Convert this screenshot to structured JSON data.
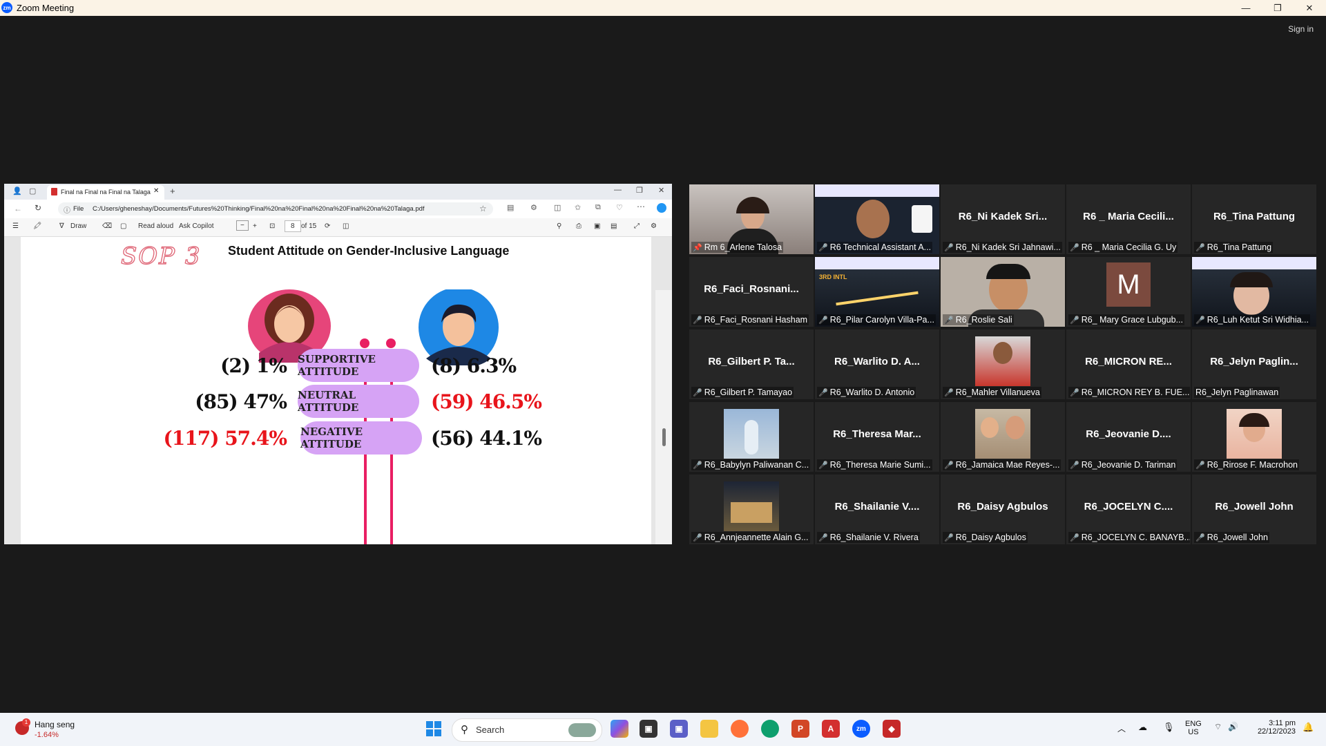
{
  "zoom": {
    "title": "Zoom Meeting",
    "logo": "zm",
    "sign_in": "Sign in",
    "window_buttons": [
      "—",
      "❐",
      "✕"
    ]
  },
  "browser": {
    "tab_title": "Final na Final na Final na Talaga.p",
    "file_label": "File",
    "url": "C:/Users/gheneshay/Documents/Futures%20Thinking/Final%20na%20Final%20na%20Final%20na%20Talaga.pdf",
    "toolbar": {
      "draw": "Draw",
      "read_aloud": "Read aloud",
      "ask_copilot": "Ask Copilot",
      "page_current": "8",
      "page_total": "of 15"
    }
  },
  "slide": {
    "sop_label": "SOP 3",
    "title": "Student Attitude on  Gender-Inclusive Language",
    "rows": [
      {
        "attitude": "SUPPORTIVE ATTITUDE",
        "female": "(2) 1%",
        "male": "(8) 6.3%",
        "female_color": "#111111",
        "male_color": "#111111"
      },
      {
        "attitude": "NEUTRAL ATTITUDE",
        "female": "(85) 47%",
        "male": "(59) 46.5%",
        "female_color": "#111111",
        "male_color": "#e8141b"
      },
      {
        "attitude": "NEGATIVE ATTITUDE",
        "female": "(117) 57.4%",
        "male": "(56) 44.1%",
        "female_color": "#e8141b",
        "male_color": "#111111"
      }
    ]
  },
  "participants": [
    {
      "big": "",
      "name": "Rm 6_Arlene Talosa",
      "video": "woman",
      "active": true,
      "pin": true
    },
    {
      "big": "",
      "name": "R6 Technical Assistant A...",
      "video": "conference-man"
    },
    {
      "big": "R6_Ni  Kadek  Sri...",
      "name": "R6_Ni Kadek Sri Jahnawi..."
    },
    {
      "big": "R6 _  Maria  Cecili...",
      "name": "R6 _ Maria Cecilia G. Uy"
    },
    {
      "big": "R6_Tina  Pattung",
      "name": "R6_Tina Pattung"
    },
    {
      "big": "R6_Faci_Rosnani...",
      "name": "R6_Faci_Rosnani Hasham"
    },
    {
      "big": "",
      "name": "R6_Pilar Carolyn Villa-Pa...",
      "video": "conference"
    },
    {
      "big": "",
      "name": "R6_Roslie Sali",
      "video": "man-glasses"
    },
    {
      "big": "M",
      "name": "R6_ Mary Grace Lubgub...",
      "video": "avatar-m"
    },
    {
      "big": "",
      "name": "R6_Luh Ketut Sri Widhia...",
      "video": "conference-girl"
    },
    {
      "big": "R6_Gilbert  P.  Ta...",
      "name": "R6_Gilbert P. Tamayao"
    },
    {
      "big": "R6_Warlito  D.  A...",
      "name": "R6_Warlito D. Antonio"
    },
    {
      "big": "",
      "name": "R6_Mahler Villanueva",
      "video": "photo-red"
    },
    {
      "big": "R6_MICRON  RE...",
      "name": "R6_MICRON REY B. FUE..."
    },
    {
      "big": "R6_Jelyn  Paglin...",
      "name": "R6_Jelyn Paglinawan",
      "nomic": true
    },
    {
      "big": "",
      "name": "R6_Babylyn Paliwanan C...",
      "video": "photo-blue"
    },
    {
      "big": "R6_Theresa  Mar...",
      "name": "R6_Theresa Marie Sumi..."
    },
    {
      "big": "",
      "name": "R6_Jamaica Mae Reyes-...",
      "video": "photo-kids"
    },
    {
      "big": "R6_Jeovanie  D....",
      "name": "R6_Jeovanie D. Tariman"
    },
    {
      "big": "",
      "name": "R6_Rirose F. Macrohon",
      "video": "photo-girl"
    },
    {
      "big": "",
      "name": "R6_Annjeannette Alain G...",
      "video": "photo-night"
    },
    {
      "big": "R6_Shailanie  V....",
      "name": "R6_Shailanie V. Rivera"
    },
    {
      "big": "R6_Daisy  Agbulos",
      "name": "R6_Daisy Agbulos"
    },
    {
      "big": "R6_JOCELYN  C....",
      "name": "R6_JOCELYN C. BANAYB..."
    },
    {
      "big": "R6_Jowell  John",
      "name": "R6_Jowell John"
    }
  ],
  "taskbar": {
    "stock_name": "Hang seng",
    "stock_change": "-1.64%",
    "stock_badge": "1",
    "search_placeholder": "Search",
    "lang_1": "ENG",
    "lang_2": "US",
    "time": "3:11 pm",
    "date": "22/12/2023",
    "accent": "#0b5cff"
  }
}
